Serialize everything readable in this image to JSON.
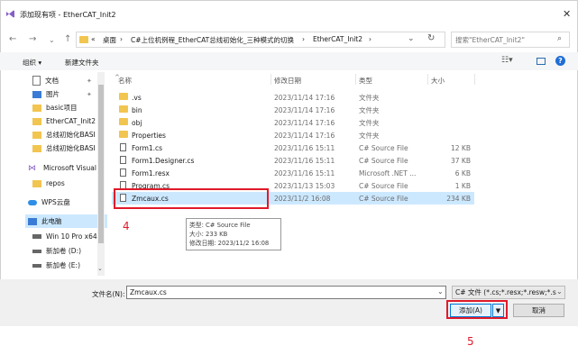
{
  "window": {
    "title": "添加现有项 - EtherCAT_Init2"
  },
  "address": {
    "prefix": "«",
    "crumbs": [
      "桌面",
      "C#上位机例程_EtherCAT总线初始化_三种模式的切换",
      "EtherCAT_Init2"
    ],
    "separators": [
      "›",
      "›",
      "›"
    ]
  },
  "search": {
    "placeholder": "搜索\"EtherCAT_Init2\""
  },
  "toolbar": {
    "organize": "组织 ▾",
    "new_folder": "新建文件夹"
  },
  "sidebar": {
    "items": [
      {
        "label": "文档",
        "icon": "document-icon",
        "pinned": true
      },
      {
        "label": "图片",
        "icon": "picture-icon",
        "pinned": true
      },
      {
        "label": "basic项目",
        "icon": "folder-icon"
      },
      {
        "label": "EtherCAT_Init2",
        "icon": "folder-icon"
      },
      {
        "label": "总线初始化BASI",
        "icon": "folder-icon"
      },
      {
        "label": "总线初始化BASI",
        "icon": "folder-icon"
      },
      {
        "label": "Microsoft Visual",
        "icon": "visual-studio-icon"
      },
      {
        "label": "repos",
        "icon": "folder-icon"
      },
      {
        "label": "WPS云盘",
        "icon": "cloud-icon"
      },
      {
        "label": "此电脑",
        "icon": "computer-icon"
      },
      {
        "label": "Win 10 Pro x64",
        "icon": "drive-icon"
      },
      {
        "label": "新加卷 (D:)",
        "icon": "drive-icon"
      },
      {
        "label": "新加卷 (E:)",
        "icon": "drive-icon"
      }
    ]
  },
  "columns": {
    "name": "名称",
    "date": "修改日期",
    "type": "类型",
    "size": "大小"
  },
  "files": [
    {
      "name": ".vs",
      "date": "2023/11/14 17:16",
      "type": "文件夹",
      "size": "",
      "kind": "folder"
    },
    {
      "name": "bin",
      "date": "2023/11/14 17:16",
      "type": "文件夹",
      "size": "",
      "kind": "folder"
    },
    {
      "name": "obj",
      "date": "2023/11/14 17:16",
      "type": "文件夹",
      "size": "",
      "kind": "folder"
    },
    {
      "name": "Properties",
      "date": "2023/11/14 17:16",
      "type": "文件夹",
      "size": "",
      "kind": "folder"
    },
    {
      "name": "Form1.cs",
      "date": "2023/11/16 15:11",
      "type": "C# Source File",
      "size": "12 KB",
      "kind": "file"
    },
    {
      "name": "Form1.Designer.cs",
      "date": "2023/11/16 15:11",
      "type": "C# Source File",
      "size": "37 KB",
      "kind": "file"
    },
    {
      "name": "Form1.resx",
      "date": "2023/11/16 15:11",
      "type": "Microsoft .NET ...",
      "size": "6 KB",
      "kind": "file"
    },
    {
      "name": "Program.cs",
      "date": "2023/11/13 15:03",
      "type": "C# Source File",
      "size": "1 KB",
      "kind": "file"
    },
    {
      "name": "Zmcaux.cs",
      "date": "2023/11/2 16:08",
      "type": "C# Source File",
      "size": "234 KB",
      "kind": "file",
      "selected": true
    }
  ],
  "tooltip": {
    "line1": "类型: C# Source File",
    "line2": "大小: 233 KB",
    "line3": "修改日期: 2023/11/2 16:08"
  },
  "filename": {
    "label": "文件名(N):",
    "value": "Zmcaux.cs"
  },
  "filter": {
    "value": "C# 文件 (*.cs;*.resx;*.resw;*.s"
  },
  "buttons": {
    "add": "添加(A)",
    "cancel": "取消"
  },
  "annotations": {
    "step4": "4",
    "step5": "5"
  },
  "colors": {
    "selection": "#cce8ff",
    "annotation_red": "#e01a2a",
    "folder": "#f1c54f"
  }
}
